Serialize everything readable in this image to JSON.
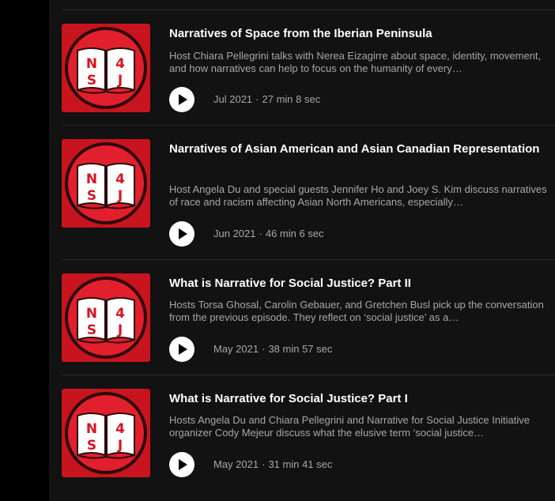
{
  "episodes": [
    {
      "title": "Narratives of Space from the Iberian Peninsula",
      "description": "Host Chiara Pellegrini talks with Nerea Eizagirre about space, identity, movement, and how narratives can help to focus on the humanity of every…",
      "date": "Jul 2021",
      "separator": "·",
      "duration": "27 min 8 sec",
      "cover_text": [
        "N",
        "4",
        "S",
        "J"
      ]
    },
    {
      "title": "Narratives of Asian American and Asian Canadian Representation",
      "description": "Host Angela Du and special guests Jennifer Ho and Joey S. Kim discuss narratives of race and racism affecting Asian North Americans, especially…",
      "date": "Jun 2021",
      "separator": "·",
      "duration": "46 min 6 sec",
      "cover_text": [
        "N",
        "4",
        "S",
        "J"
      ]
    },
    {
      "title": "What is Narrative for Social Justice? Part II",
      "description": "Hosts Torsa Ghosal, Carolin Gebauer, and Gretchen Busl pick up the conversation from the previous episode. They reflect on ‘social justice’ as a…",
      "date": "May 2021",
      "separator": "·",
      "duration": "38 min 57 sec",
      "cover_text": [
        "N",
        "4",
        "S",
        "J"
      ]
    },
    {
      "title": "What is Narrative for Social Justice? Part I",
      "description": "Hosts Angela Du and Chiara Pellegrini and Narrative for Social Justice Initiative organizer Cody Mejeur discuss what the elusive term ‘social justice…",
      "date": "May 2021",
      "separator": "·",
      "duration": "31 min 41 sec",
      "cover_text": [
        "N",
        "4",
        "S",
        "J"
      ]
    }
  ],
  "colors": {
    "background": "#121212",
    "cover_red": "#c8141e",
    "title": "#ffffff",
    "muted": "#a7a7a7",
    "divider": "#2a2a2a"
  },
  "icons": {
    "play": "play-icon"
  }
}
